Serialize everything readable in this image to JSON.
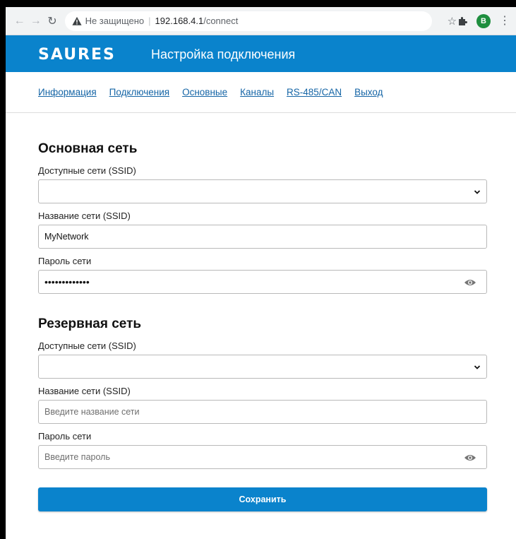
{
  "browser": {
    "security_label": "Не защищено",
    "url_host": "192.168.4.1",
    "url_path": "/connect",
    "profile_initial": "B"
  },
  "header": {
    "logo_text": "SAURES",
    "title": "Настройка подключения",
    "brand_color": "#0a83cc"
  },
  "nav": {
    "items": [
      "Информация",
      "Подключения",
      "Основные",
      "Каналы",
      "RS-485/CAN",
      "Выход"
    ]
  },
  "primary": {
    "title": "Основная сеть",
    "available_label": "Доступные сети (SSID)",
    "available_value": "",
    "ssid_label": "Название сети (SSID)",
    "ssid_value": "MyNetwork",
    "password_label": "Пароль сети",
    "password_masked": "•••••••••••••"
  },
  "backup": {
    "title": "Резервная сеть",
    "available_label": "Доступные сети (SSID)",
    "available_value": "",
    "ssid_label": "Название сети (SSID)",
    "ssid_placeholder": "Введите название сети",
    "password_label": "Пароль сети",
    "password_placeholder": "Введите пароль"
  },
  "actions": {
    "save_label": "Сохранить"
  },
  "icons": [
    "back-icon",
    "forward-icon",
    "reload-icon",
    "warning-icon",
    "star-icon",
    "extensions-icon",
    "menu-icon",
    "chevron-down-icon",
    "eye-icon"
  ]
}
